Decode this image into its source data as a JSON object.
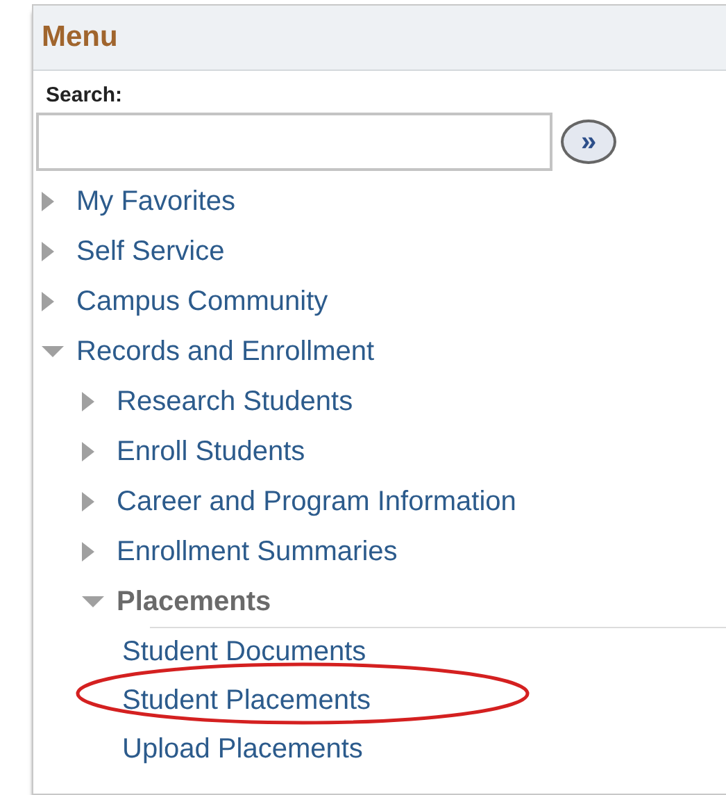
{
  "menu": {
    "title": "Menu",
    "search": {
      "label": "Search:",
      "go_symbol": "»"
    },
    "items": [
      {
        "label": "My Favorites",
        "expanded": false,
        "active": false
      },
      {
        "label": "Self Service",
        "expanded": false,
        "active": false
      },
      {
        "label": "Campus Community",
        "expanded": false,
        "active": false
      },
      {
        "label": "Records and Enrollment",
        "expanded": true,
        "active": false,
        "children": [
          {
            "label": "Research Students",
            "expanded": false,
            "active": false
          },
          {
            "label": "Enroll Students",
            "expanded": false,
            "active": false
          },
          {
            "label": "Career and Program Information",
            "expanded": false,
            "active": false
          },
          {
            "label": "Enrollment Summaries",
            "expanded": false,
            "active": false
          },
          {
            "label": "Placements",
            "expanded": true,
            "active": true,
            "children": [
              {
                "label": "Student Documents",
                "circled": false
              },
              {
                "label": "Student Placements",
                "circled": true
              },
              {
                "label": "Upload Placements",
                "circled": false
              }
            ]
          }
        ]
      }
    ]
  }
}
